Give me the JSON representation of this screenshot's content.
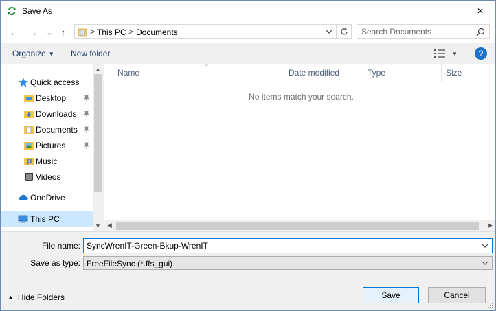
{
  "window": {
    "title": "Save As",
    "app_icon": "freefilesync-app-icon",
    "close_glyph": "✕"
  },
  "nav": {
    "back_glyph": "←",
    "forward_glyph": "→",
    "recent_glyph": "⌄",
    "up_glyph": "↑",
    "breadcrumb": [
      "This PC",
      "Documents"
    ],
    "separator": ">",
    "search_placeholder": "Search Documents"
  },
  "toolbar": {
    "organize_label": "Organize",
    "new_folder_label": "New folder",
    "help_label": "?"
  },
  "sidebar": {
    "items": [
      {
        "label": "Quick access",
        "icon": "star-icon",
        "pinned": false
      },
      {
        "label": "Desktop",
        "icon": "desktop-folder-icon",
        "pinned": true
      },
      {
        "label": "Downloads",
        "icon": "downloads-folder-icon",
        "pinned": true
      },
      {
        "label": "Documents",
        "icon": "documents-folder-icon",
        "pinned": true
      },
      {
        "label": "Pictures",
        "icon": "pictures-folder-icon",
        "pinned": true
      },
      {
        "label": "Music",
        "icon": "music-folder-icon",
        "pinned": false
      },
      {
        "label": "Videos",
        "icon": "videos-folder-icon",
        "pinned": false
      },
      {
        "label": "OneDrive",
        "icon": "cloud-icon",
        "pinned": false
      },
      {
        "label": "This PC",
        "icon": "computer-icon",
        "pinned": false,
        "selected": true
      }
    ]
  },
  "filelist": {
    "columns": [
      "Name",
      "Date modified",
      "Type",
      "Size"
    ],
    "empty_message": "No items match your search."
  },
  "form": {
    "filename_label": "File name:",
    "filename_value": "SyncWrenIT-Green-Bkup-WrenIT",
    "savetype_label": "Save as type:",
    "savetype_value": "FreeFileSync (*.ffs_gui)"
  },
  "footer": {
    "hide_folders_label": "Hide Folders",
    "save_label": "Save",
    "cancel_label": "Cancel"
  },
  "colors": {
    "accent": "#0078d7",
    "selection": "#cce8ff",
    "link": "#1c3c6a",
    "help": "#1e71c9"
  }
}
